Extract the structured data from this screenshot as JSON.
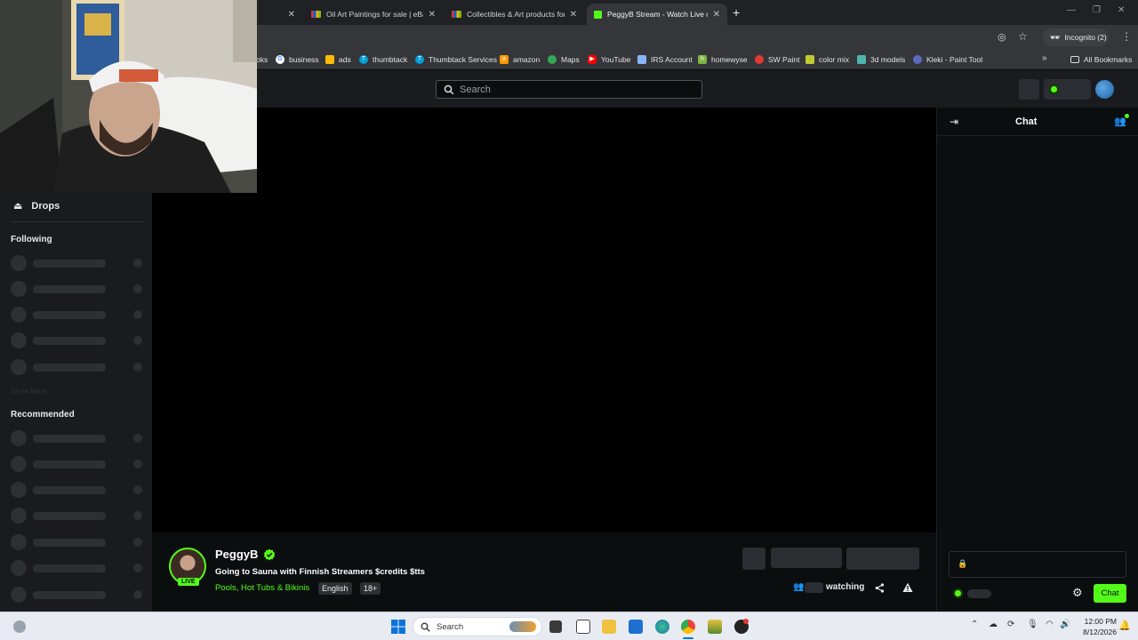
{
  "browser": {
    "tabs": [
      {
        "title": "",
        "active": false
      },
      {
        "title": "Oil Art Paintings for sale | eBay",
        "active": false
      },
      {
        "title": "Collectibles & Art products for",
        "active": false
      },
      {
        "title": "PeggyB Stream - Watch Live on",
        "active": true
      }
    ],
    "new_tab": "+",
    "incognito_label": "Incognito (2)",
    "bookmarks": [
      {
        "label": "oks",
        "color": "#35363a"
      },
      {
        "label": "business",
        "color": "#4285f4"
      },
      {
        "label": "ads",
        "color": "#fbbc05"
      },
      {
        "label": "thumbtack",
        "color": "#009fd9"
      },
      {
        "label": "Thumbtack Services",
        "color": "#009fd9"
      },
      {
        "label": "amazon",
        "color": "#ff9900"
      },
      {
        "label": "Maps",
        "color": "#34a853"
      },
      {
        "label": "YouTube",
        "color": "#ff0000"
      },
      {
        "label": "IRS Account",
        "color": "#8ab4f8"
      },
      {
        "label": "homewyse",
        "color": "#7cb342"
      },
      {
        "label": "SW Paint",
        "color": "#e53935"
      },
      {
        "label": "color mix",
        "color": "#c0ca33"
      },
      {
        "label": "3d models",
        "color": "#4db6ac"
      },
      {
        "label": "Kleki - Paint Tool",
        "color": "#5c6bc0"
      }
    ],
    "all_bookmarks": "All Bookmarks"
  },
  "kick": {
    "search_placeholder": "Search",
    "sidebar": {
      "drops_label": "Drops",
      "following_label": "Following",
      "show_more_label": "Show More",
      "recommended_label": "Recommended"
    },
    "chat": {
      "title": "Chat",
      "send_label": "Chat"
    },
    "stream": {
      "channel_name": "PeggyB",
      "live_badge": "LIVE",
      "title": "Going to Sauna with Finnish Streamers $credits $tts",
      "category": "Pools, Hot Tubs & Bikinis",
      "tags": [
        "English",
        "18+"
      ],
      "watching_label": "watching"
    },
    "brand_green": "#53fc18"
  },
  "taskbar": {
    "search_label": "Search",
    "time": "12:00 PM",
    "date": "8/12/2026"
  }
}
